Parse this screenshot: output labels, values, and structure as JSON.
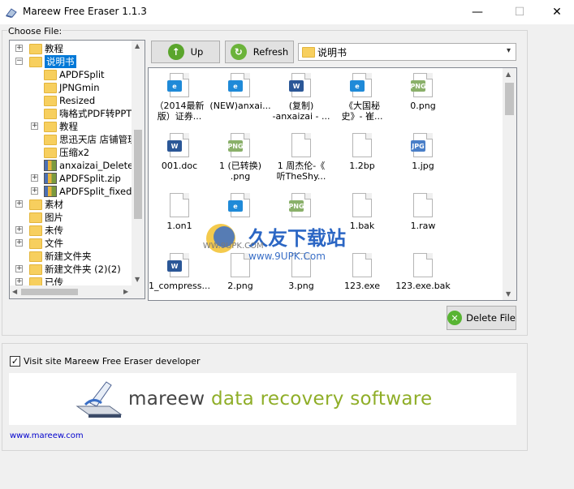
{
  "window": {
    "title": "Mareew Free Eraser 1.1.3",
    "minimize": "—",
    "maximize": "☐",
    "close": "✕"
  },
  "choose_file_label": "Choose File:",
  "tree": [
    {
      "label": "教程",
      "expander": "+",
      "indent": 0,
      "icon": "folder"
    },
    {
      "label": "说明书",
      "expander": "−",
      "indent": 0,
      "icon": "folder",
      "selected": true
    },
    {
      "label": "APDFSplit",
      "indent": 1,
      "icon": "folder"
    },
    {
      "label": "JPNGmin",
      "indent": 1,
      "icon": "folder"
    },
    {
      "label": "Resized",
      "indent": 1,
      "icon": "folder"
    },
    {
      "label": "嗨格式PDF转PPT",
      "indent": 1,
      "icon": "folder"
    },
    {
      "label": "教程",
      "expander": "+",
      "indent": 1,
      "icon": "folder"
    },
    {
      "label": "思迅天店 店铺管理",
      "indent": 1,
      "icon": "folder"
    },
    {
      "label": "压缩x2",
      "indent": 1,
      "icon": "folder"
    },
    {
      "label": "anxaizai_Deleted.zi",
      "indent": 1,
      "icon": "zip"
    },
    {
      "label": "APDFSplit.zip",
      "expander": "+",
      "indent": 1,
      "icon": "zip"
    },
    {
      "label": "APDFSplit_fixed.zip",
      "expander": "+",
      "indent": 1,
      "icon": "zip"
    },
    {
      "label": "素材",
      "expander": "+",
      "indent": 0,
      "icon": "folder"
    },
    {
      "label": "图片",
      "indent": 0,
      "icon": "folder"
    },
    {
      "label": "未传",
      "expander": "+",
      "indent": 0,
      "icon": "folder"
    },
    {
      "label": "文件",
      "expander": "+",
      "indent": 0,
      "icon": "folder"
    },
    {
      "label": "新建文件夹",
      "indent": 0,
      "icon": "folder"
    },
    {
      "label": "新建文件夹 (2)(2)",
      "expander": "+",
      "indent": 0,
      "icon": "folder"
    },
    {
      "label": "已传",
      "expander": "+",
      "indent": 0,
      "icon": "folder"
    }
  ],
  "toolbar": {
    "up_label": "Up",
    "refresh_label": "Refresh",
    "path": "说明书",
    "delete_label": "Delete File"
  },
  "files": [
    {
      "name": "（2014最新\n版）证券...",
      "icon": "html"
    },
    {
      "name": "(NEW)anxai...",
      "icon": "html"
    },
    {
      "name": "(复制)\n-anxaizai - ...",
      "icon": "word"
    },
    {
      "name": "《大国秘\n史》- 崔...",
      "icon": "html"
    },
    {
      "name": "0.png",
      "icon": "png"
    },
    {
      "name": "001.doc",
      "icon": "word"
    },
    {
      "name": "1 (已转换)\n.png",
      "icon": "png"
    },
    {
      "name": "1 周杰伦-《\n听TheShy...",
      "icon": "blank"
    },
    {
      "name": "1.2bp",
      "icon": "blank"
    },
    {
      "name": "1.jpg",
      "icon": "jpg"
    },
    {
      "name": "1.on1",
      "icon": "blank"
    },
    {
      "name": "",
      "icon": "edge"
    },
    {
      "name": "",
      "icon": "png"
    },
    {
      "name": "1.bak",
      "icon": "blank"
    },
    {
      "name": "1.raw",
      "icon": "blank"
    },
    {
      "name": "1_compress...",
      "icon": "word"
    },
    {
      "name": "2.png",
      "icon": "blank"
    },
    {
      "name": "3.png",
      "icon": "blank"
    },
    {
      "name": "123.exe",
      "icon": "blank"
    },
    {
      "name": "123.exe.bak",
      "icon": "blank"
    }
  ],
  "watermark": {
    "title": "久友下载站",
    "url": "WWW.9UPK.COM",
    "url2": "www.9UPK.Com"
  },
  "footer": {
    "visit_label": "Visit site Mareew Free Eraser developer",
    "visit_checked": "✓",
    "banner_part1": "mareew",
    "banner_part2": "data recovery software",
    "site_link": "www.mareew.com"
  },
  "colors": {
    "selection": "#0078d7",
    "brand_green": "#8fae28",
    "up_icon": "#5aa52c",
    "delete_icon": "#58b433"
  }
}
